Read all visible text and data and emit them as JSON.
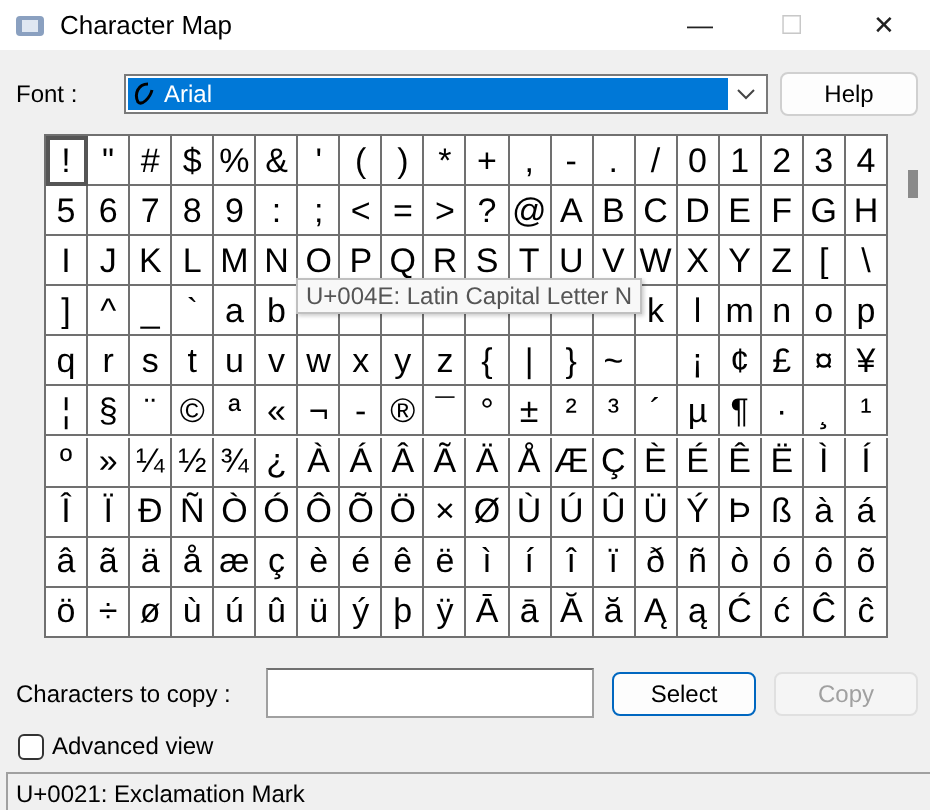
{
  "window": {
    "title": "Character Map",
    "controls": [
      {
        "glyph": "—",
        "disabled": false
      },
      {
        "glyph": "☐",
        "disabled": true
      },
      {
        "glyph": "✕",
        "disabled": false
      }
    ]
  },
  "font": {
    "label": "Font :",
    "value": "Arial",
    "button": "Help"
  },
  "grid": [
    [
      {
        "ch": "!",
        "selected": true
      },
      {
        "ch": "\"",
        "selected": false
      },
      {
        "ch": "#",
        "selected": false
      },
      {
        "ch": "$",
        "selected": false
      },
      {
        "ch": "%",
        "selected": false
      },
      {
        "ch": "&",
        "selected": false
      },
      {
        "ch": "'",
        "selected": false
      },
      {
        "ch": "(",
        "selected": false
      },
      {
        "ch": ")",
        "selected": false
      },
      {
        "ch": "*",
        "selected": false
      },
      {
        "ch": "+",
        "selected": false
      },
      {
        "ch": ",",
        "selected": false
      },
      {
        "ch": "-",
        "selected": false
      },
      {
        "ch": ".",
        "selected": false
      },
      {
        "ch": "/",
        "selected": false
      },
      {
        "ch": "0",
        "selected": false
      },
      {
        "ch": "1",
        "selected": false
      },
      {
        "ch": "2",
        "selected": false
      },
      {
        "ch": "3",
        "selected": false
      },
      {
        "ch": "4",
        "selected": false
      }
    ],
    [
      {
        "ch": "5",
        "selected": false
      },
      {
        "ch": "6",
        "selected": false
      },
      {
        "ch": "7",
        "selected": false
      },
      {
        "ch": "8",
        "selected": false
      },
      {
        "ch": "9",
        "selected": false
      },
      {
        "ch": ":",
        "selected": false
      },
      {
        "ch": ";",
        "selected": false
      },
      {
        "ch": "<",
        "selected": false
      },
      {
        "ch": "=",
        "selected": false
      },
      {
        "ch": ">",
        "selected": false
      },
      {
        "ch": "?",
        "selected": false
      },
      {
        "ch": "@",
        "selected": false
      },
      {
        "ch": "A",
        "selected": false
      },
      {
        "ch": "B",
        "selected": false
      },
      {
        "ch": "C",
        "selected": false
      },
      {
        "ch": "D",
        "selected": false
      },
      {
        "ch": "E",
        "selected": false
      },
      {
        "ch": "F",
        "selected": false
      },
      {
        "ch": "G",
        "selected": false
      },
      {
        "ch": "H",
        "selected": false
      }
    ],
    [
      {
        "ch": "I",
        "selected": false
      },
      {
        "ch": "J",
        "selected": false
      },
      {
        "ch": "K",
        "selected": false
      },
      {
        "ch": "L",
        "selected": false
      },
      {
        "ch": "M",
        "selected": false
      },
      {
        "ch": "N",
        "selected": false
      },
      {
        "ch": "O",
        "selected": false
      },
      {
        "ch": "P",
        "selected": false
      },
      {
        "ch": "Q",
        "selected": false
      },
      {
        "ch": "R",
        "selected": false
      },
      {
        "ch": "S",
        "selected": false
      },
      {
        "ch": "T",
        "selected": false
      },
      {
        "ch": "U",
        "selected": false
      },
      {
        "ch": "V",
        "selected": false
      },
      {
        "ch": "W",
        "selected": false
      },
      {
        "ch": "X",
        "selected": false
      },
      {
        "ch": "Y",
        "selected": false
      },
      {
        "ch": "Z",
        "selected": false
      },
      {
        "ch": "[",
        "selected": false
      },
      {
        "ch": "\\",
        "selected": false
      }
    ],
    [
      {
        "ch": "]",
        "selected": false
      },
      {
        "ch": "^",
        "selected": false
      },
      {
        "ch": "_",
        "selected": false
      },
      {
        "ch": "`",
        "selected": false
      },
      {
        "ch": "a",
        "selected": false
      },
      {
        "ch": "b",
        "selected": false
      },
      {
        "selected": false
      },
      {
        "selected": false
      },
      {
        "selected": false
      },
      {
        "selected": false
      },
      {
        "selected": false
      },
      {
        "selected": false
      },
      {
        "selected": false
      },
      {
        "selected": false
      },
      {
        "ch": "k",
        "selected": false
      },
      {
        "ch": "l",
        "selected": false
      },
      {
        "ch": "m",
        "selected": false
      },
      {
        "ch": "n",
        "selected": false
      },
      {
        "ch": "o",
        "selected": false
      },
      {
        "ch": "p",
        "selected": false
      }
    ],
    [
      {
        "ch": "q",
        "selected": false
      },
      {
        "ch": "r",
        "selected": false
      },
      {
        "ch": "s",
        "selected": false
      },
      {
        "ch": "t",
        "selected": false
      },
      {
        "ch": "u",
        "selected": false
      },
      {
        "ch": "v",
        "selected": false
      },
      {
        "ch": "w",
        "selected": false
      },
      {
        "ch": "x",
        "selected": false
      },
      {
        "ch": "y",
        "selected": false
      },
      {
        "ch": "z",
        "selected": false
      },
      {
        "ch": "{",
        "selected": false
      },
      {
        "ch": "|",
        "selected": false
      },
      {
        "ch": "}",
        "selected": false
      },
      {
        "ch": "~",
        "selected": false
      },
      {
        "selected": false
      },
      {
        "ch": "¡",
        "selected": false
      },
      {
        "ch": "¢",
        "selected": false
      },
      {
        "ch": "£",
        "selected": false
      },
      {
        "ch": "¤",
        "selected": false
      },
      {
        "ch": "¥",
        "selected": false
      }
    ],
    [
      {
        "ch": "¦",
        "selected": false
      },
      {
        "ch": "§",
        "selected": false
      },
      {
        "ch": "¨",
        "selected": false
      },
      {
        "ch": "©",
        "selected": false
      },
      {
        "ch": "ª",
        "selected": false
      },
      {
        "ch": "«",
        "selected": false
      },
      {
        "ch": "¬",
        "selected": false
      },
      {
        "ch": "-",
        "selected": false
      },
      {
        "ch": "®",
        "selected": false
      },
      {
        "ch": "¯",
        "selected": false
      },
      {
        "ch": "°",
        "selected": false
      },
      {
        "ch": "±",
        "selected": false
      },
      {
        "ch": "²",
        "selected": false
      },
      {
        "ch": "³",
        "selected": false
      },
      {
        "ch": "´",
        "selected": false
      },
      {
        "ch": "µ",
        "selected": false
      },
      {
        "ch": "¶",
        "selected": false
      },
      {
        "ch": "·",
        "selected": false
      },
      {
        "ch": "¸",
        "selected": false
      },
      {
        "ch": "¹",
        "selected": false
      }
    ],
    [
      {
        "ch": "º",
        "selected": false
      },
      {
        "ch": "»",
        "selected": false
      },
      {
        "ch": "¼",
        "selected": false
      },
      {
        "ch": "½",
        "selected": false
      },
      {
        "ch": "¾",
        "selected": false
      },
      {
        "ch": "¿",
        "selected": false
      },
      {
        "ch": "À",
        "selected": false
      },
      {
        "ch": "Á",
        "selected": false
      },
      {
        "ch": "Â",
        "selected": false
      },
      {
        "ch": "Ã",
        "selected": false
      },
      {
        "ch": "Ä",
        "selected": false
      },
      {
        "ch": "Å",
        "selected": false
      },
      {
        "ch": "Æ",
        "selected": false
      },
      {
        "ch": "Ç",
        "selected": false
      },
      {
        "ch": "È",
        "selected": false
      },
      {
        "ch": "É",
        "selected": false
      },
      {
        "ch": "Ê",
        "selected": false
      },
      {
        "ch": "Ë",
        "selected": false
      },
      {
        "ch": "Ì",
        "selected": false
      },
      {
        "ch": "Í",
        "selected": false
      }
    ],
    [
      {
        "ch": "Î",
        "selected": false
      },
      {
        "ch": "Ï",
        "selected": false
      },
      {
        "ch": "Ð",
        "selected": false
      },
      {
        "ch": "Ñ",
        "selected": false
      },
      {
        "ch": "Ò",
        "selected": false
      },
      {
        "ch": "Ó",
        "selected": false
      },
      {
        "ch": "Ô",
        "selected": false
      },
      {
        "ch": "Õ",
        "selected": false
      },
      {
        "ch": "Ö",
        "selected": false
      },
      {
        "ch": "×",
        "selected": false
      },
      {
        "ch": "Ø",
        "selected": false
      },
      {
        "ch": "Ù",
        "selected": false
      },
      {
        "ch": "Ú",
        "selected": false
      },
      {
        "ch": "Û",
        "selected": false
      },
      {
        "ch": "Ü",
        "selected": false
      },
      {
        "ch": "Ý",
        "selected": false
      },
      {
        "ch": "Þ",
        "selected": false
      },
      {
        "ch": "ß",
        "selected": false
      },
      {
        "ch": "à",
        "selected": false
      },
      {
        "ch": "á",
        "selected": false
      }
    ],
    [
      {
        "ch": "â",
        "selected": false
      },
      {
        "ch": "ã",
        "selected": false
      },
      {
        "ch": "ä",
        "selected": false
      },
      {
        "ch": "å",
        "selected": false
      },
      {
        "ch": "æ",
        "selected": false
      },
      {
        "ch": "ç",
        "selected": false
      },
      {
        "ch": "è",
        "selected": false
      },
      {
        "ch": "é",
        "selected": false
      },
      {
        "ch": "ê",
        "selected": false
      },
      {
        "ch": "ë",
        "selected": false
      },
      {
        "ch": "ì",
        "selected": false
      },
      {
        "ch": "í",
        "selected": false
      },
      {
        "ch": "î",
        "selected": false
      },
      {
        "ch": "ï",
        "selected": false
      },
      {
        "ch": "ð",
        "selected": false
      },
      {
        "ch": "ñ",
        "selected": false
      },
      {
        "ch": "ò",
        "selected": false
      },
      {
        "ch": "ó",
        "selected": false
      },
      {
        "ch": "ô",
        "selected": false
      },
      {
        "ch": "õ",
        "selected": false
      }
    ],
    [
      {
        "ch": "ö",
        "selected": false
      },
      {
        "ch": "÷",
        "selected": false
      },
      {
        "ch": "ø",
        "selected": false
      },
      {
        "ch": "ù",
        "selected": false
      },
      {
        "ch": "ú",
        "selected": false
      },
      {
        "ch": "û",
        "selected": false
      },
      {
        "ch": "ü",
        "selected": false
      },
      {
        "ch": "ý",
        "selected": false
      },
      {
        "ch": "þ",
        "selected": false
      },
      {
        "ch": "ÿ",
        "selected": false
      },
      {
        "ch": "Ā",
        "selected": false
      },
      {
        "ch": "ā",
        "selected": false
      },
      {
        "ch": "Ă",
        "selected": false
      },
      {
        "ch": "ă",
        "selected": false
      },
      {
        "ch": "Ą",
        "selected": false
      },
      {
        "ch": "ą",
        "selected": false
      },
      {
        "ch": "Ć",
        "selected": false
      },
      {
        "ch": "ć",
        "selected": false
      },
      {
        "ch": "Ĉ",
        "selected": false
      },
      {
        "ch": "ĉ",
        "selected": false
      }
    ]
  ],
  "tooltip": "U+004E: Latin Capital Letter N",
  "copy": {
    "label": "Characters to copy :",
    "select": "Select",
    "copy": {
      "label": "Copy",
      "disabled": true
    }
  },
  "advanced": {
    "label": "Advanced view",
    "checked": false
  },
  "status_bar": "U+0021: Exclamation Mark"
}
